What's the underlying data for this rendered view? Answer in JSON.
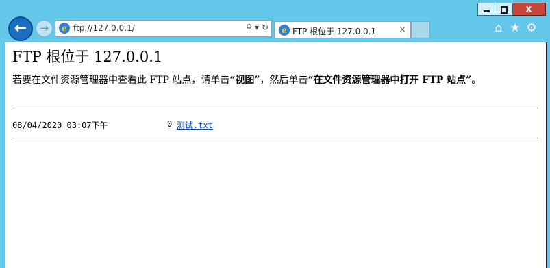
{
  "window": {
    "close_glyph": "x"
  },
  "address_bar": {
    "url": "ftp://127.0.0.1/"
  },
  "tab": {
    "title": "FTP 根位于 127.0.0.1",
    "close_glyph": "×"
  },
  "page": {
    "heading": "FTP  根位于  127.0.0.1",
    "instructions": {
      "part1": "若要在文件资源管理器中查看此 FTP 站点，请单击",
      "view_label": "“视图”",
      "part2": "，然后单击",
      "open_label": "“在文件资源管理器中打开 FTP 站点”",
      "part3": "。"
    },
    "listing": [
      {
        "date": "08/04/2020 03:07下午",
        "size": "0",
        "name": "测试.txt"
      }
    ]
  },
  "icons": {
    "back": "back-arrow-icon",
    "forward": "forward-arrow-icon",
    "browser": "internet-explorer-icon",
    "search": "search-icon",
    "dropdown": "chevron-down-icon",
    "refresh": "refresh-icon",
    "home": "home-icon",
    "favorites": "star-icon",
    "tools": "gear-icon"
  },
  "colors": {
    "chrome": "#64c8ea",
    "close_button": "#c7463a",
    "back_button": "#1a6fc0",
    "link": "#0645ad"
  }
}
